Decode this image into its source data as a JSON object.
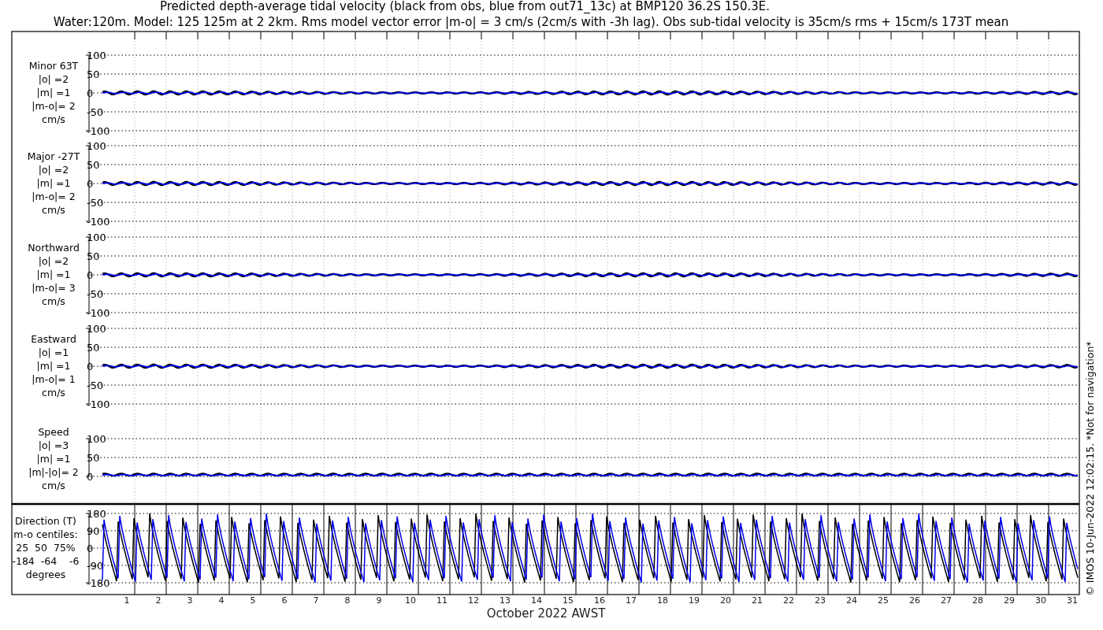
{
  "title_lines": [
    "Predicted depth-average tidal velocity (black from obs, blue from out71_13c) at BMP120 36.2S 150.3E.",
    "Water:120m. Model: 125 125m at 2 2km. Rms model vector error |m-o| = 3 cm/s (2cm/s with -3h lag). Obs sub-tidal velocity is 35cm/s rms + 15cm/s 173T mean"
  ],
  "panels": [
    {
      "kind": "velocity",
      "labels": [
        "Minor 63T",
        "|o| =2",
        "|m| =1",
        "|m-o|= 2",
        "cm/s"
      ],
      "yticks": [
        "100",
        "50",
        "0",
        "-50",
        "-100"
      ]
    },
    {
      "kind": "velocity",
      "labels": [
        "Major -27T",
        "|o| =2",
        "|m| =1",
        "|m-o|= 2",
        "cm/s"
      ],
      "yticks": [
        "100",
        "50",
        "0",
        "-50",
        "-100"
      ]
    },
    {
      "kind": "velocity",
      "labels": [
        "Northward",
        "|o| =2",
        "|m| =1",
        "|m-o|= 3",
        "cm/s"
      ],
      "yticks": [
        "100",
        "50",
        "0",
        "-50",
        "-100"
      ]
    },
    {
      "kind": "velocity",
      "labels": [
        "Eastward",
        "|o| =1",
        "|m| =1",
        "|m-o|= 1",
        "cm/s"
      ],
      "yticks": [
        "100",
        "50",
        "0",
        "-50",
        "-100"
      ]
    },
    {
      "kind": "speed",
      "labels": [
        "Speed",
        "|o| =3",
        "|m| =1",
        "|m|-|o|= 2",
        "cm/s"
      ],
      "yticks": [
        "100",
        "50",
        "0"
      ]
    },
    {
      "kind": "direction",
      "labels": [
        "Direction (T)",
        "m-o centiles:",
        "25  50  75%",
        "-184  -64    -6",
        "degrees"
      ],
      "yticks": [
        "180",
        "90",
        "0",
        "-90",
        "-180"
      ]
    }
  ],
  "days": [
    "1",
    "2",
    "3",
    "4",
    "5",
    "6",
    "7",
    "8",
    "9",
    "10",
    "11",
    "12",
    "13",
    "14",
    "15",
    "16",
    "17",
    "18",
    "19",
    "20",
    "21",
    "22",
    "23",
    "24",
    "25",
    "26",
    "27",
    "28",
    "29",
    "30",
    "31"
  ],
  "xlabel": "October 2022 AWST",
  "credit": "© IMOS 10-Jun-2022 12:02:15. *Not for navigation*"
}
